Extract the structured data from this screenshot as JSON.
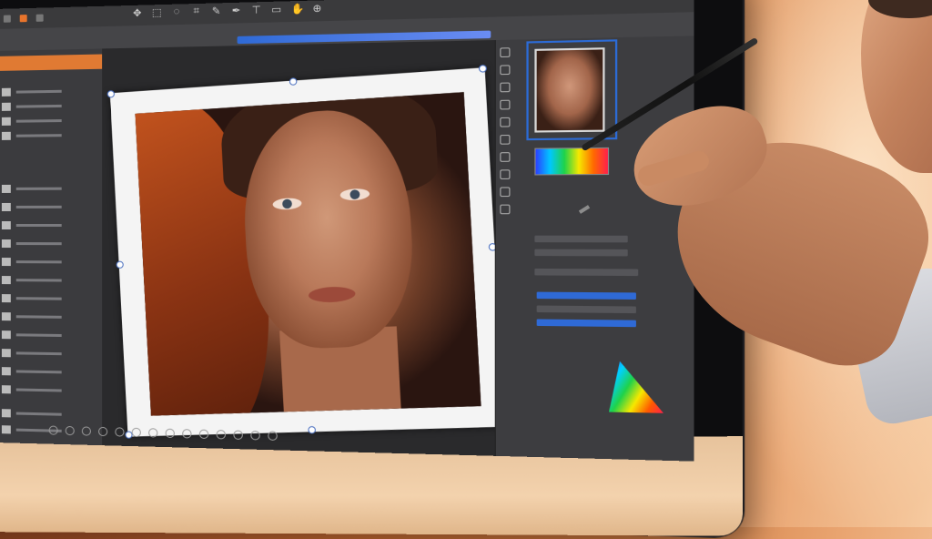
{
  "app": {
    "menubar_icons": [
      "logo-icon",
      "file-icon",
      "grid-icon"
    ],
    "toolbar_icons": [
      "move-icon",
      "marquee-icon",
      "lasso-icon",
      "crop-icon",
      "brush-icon",
      "pen-icon",
      "text-icon",
      "shape-icon",
      "hand-icon",
      "zoom-icon"
    ]
  },
  "colors": {
    "accent": "#e07a33",
    "selection": "#2f6ad6",
    "panel": "#3b3b3e"
  }
}
